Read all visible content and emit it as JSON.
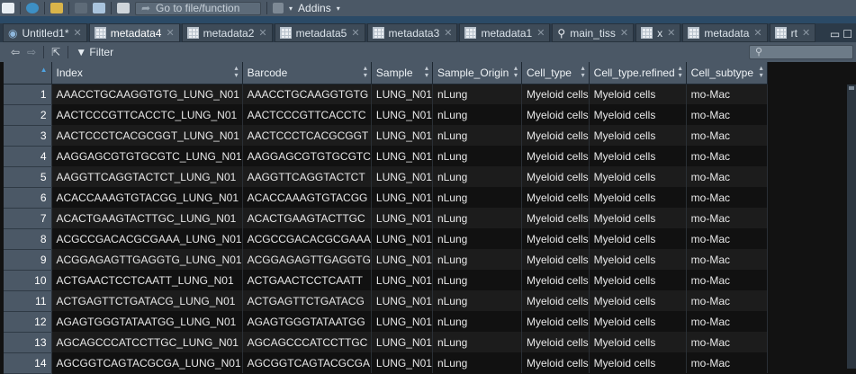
{
  "toolbar": {
    "goto_placeholder": "Go to file/function",
    "addins_label": "Addins"
  },
  "tabs": [
    {
      "label": "Untitled1*",
      "icon": "r-script-icon",
      "active": false
    },
    {
      "label": "metadata4",
      "icon": "table-icon",
      "active": true
    },
    {
      "label": "metadata2",
      "icon": "table-icon",
      "active": false
    },
    {
      "label": "metadata5",
      "icon": "table-icon",
      "active": false
    },
    {
      "label": "metadata3",
      "icon": "table-icon",
      "active": false
    },
    {
      "label": "metadata1",
      "icon": "table-icon",
      "active": false
    },
    {
      "label": "main_tiss",
      "icon": "search-icon",
      "active": false
    },
    {
      "label": "x",
      "icon": "table-icon",
      "active": false
    },
    {
      "label": "metadata",
      "icon": "table-icon",
      "active": false
    },
    {
      "label": "rt",
      "icon": "table-icon",
      "active": false
    }
  ],
  "filterbar": {
    "filter_label": "Filter"
  },
  "table": {
    "columns": [
      "Index",
      "Barcode",
      "Sample",
      "Sample_Origin",
      "Cell_type",
      "Cell_type.refined",
      "Cell_subtype"
    ],
    "rows": [
      [
        "1",
        "AAACCTGCAAGGTGTG_LUNG_N01",
        "AAACCTGCAAGGTGTG",
        "LUNG_N01",
        "nLung",
        "Myeloid cells",
        "Myeloid cells",
        "mo-Mac"
      ],
      [
        "2",
        "AACTCCCGTTCACCTC_LUNG_N01",
        "AACTCCCGTTCACCTC",
        "LUNG_N01",
        "nLung",
        "Myeloid cells",
        "Myeloid cells",
        "mo-Mac"
      ],
      [
        "3",
        "AACTCCCTCACGCGGT_LUNG_N01",
        "AACTCCCTCACGCGGT",
        "LUNG_N01",
        "nLung",
        "Myeloid cells",
        "Myeloid cells",
        "mo-Mac"
      ],
      [
        "4",
        "AAGGAGCGTGTGCGTC_LUNG_N01",
        "AAGGAGCGTGTGCGTC",
        "LUNG_N01",
        "nLung",
        "Myeloid cells",
        "Myeloid cells",
        "mo-Mac"
      ],
      [
        "5",
        "AAGGTTCAGGTACTCT_LUNG_N01",
        "AAGGTTCAGGTACTCT",
        "LUNG_N01",
        "nLung",
        "Myeloid cells",
        "Myeloid cells",
        "mo-Mac"
      ],
      [
        "6",
        "ACACCAAAGTGTACGG_LUNG_N01",
        "ACACCAAAGTGTACGG",
        "LUNG_N01",
        "nLung",
        "Myeloid cells",
        "Myeloid cells",
        "mo-Mac"
      ],
      [
        "7",
        "ACACTGAAGTACTTGC_LUNG_N01",
        "ACACTGAAGTACTTGC",
        "LUNG_N01",
        "nLung",
        "Myeloid cells",
        "Myeloid cells",
        "mo-Mac"
      ],
      [
        "8",
        "ACGCCGACACGCGAAA_LUNG_N01",
        "ACGCCGACACGCGAAA",
        "LUNG_N01",
        "nLung",
        "Myeloid cells",
        "Myeloid cells",
        "mo-Mac"
      ],
      [
        "9",
        "ACGGAGAGTTGAGGTG_LUNG_N01",
        "ACGGAGAGTTGAGGTG",
        "LUNG_N01",
        "nLung",
        "Myeloid cells",
        "Myeloid cells",
        "mo-Mac"
      ],
      [
        "10",
        "ACTGAACTCCTCAATT_LUNG_N01",
        "ACTGAACTCCTCAATT",
        "LUNG_N01",
        "nLung",
        "Myeloid cells",
        "Myeloid cells",
        "mo-Mac"
      ],
      [
        "11",
        "ACTGAGTTCTGATACG_LUNG_N01",
        "ACTGAGTTCTGATACG",
        "LUNG_N01",
        "nLung",
        "Myeloid cells",
        "Myeloid cells",
        "mo-Mac"
      ],
      [
        "12",
        "AGAGTGGGTATAATGG_LUNG_N01",
        "AGAGTGGGTATAATGG",
        "LUNG_N01",
        "nLung",
        "Myeloid cells",
        "Myeloid cells",
        "mo-Mac"
      ],
      [
        "13",
        "AGCAGCCCATCCTTGC_LUNG_N01",
        "AGCAGCCCATCCTTGC",
        "LUNG_N01",
        "nLung",
        "Myeloid cells",
        "Myeloid cells",
        "mo-Mac"
      ],
      [
        "14",
        "AGCGGTCAGTACGCGA_LUNG_N01",
        "AGCGGTCAGTACGCGA",
        "LUNG_N01",
        "nLung",
        "Myeloid cells",
        "Myeloid cells",
        "mo-Mac"
      ]
    ]
  }
}
